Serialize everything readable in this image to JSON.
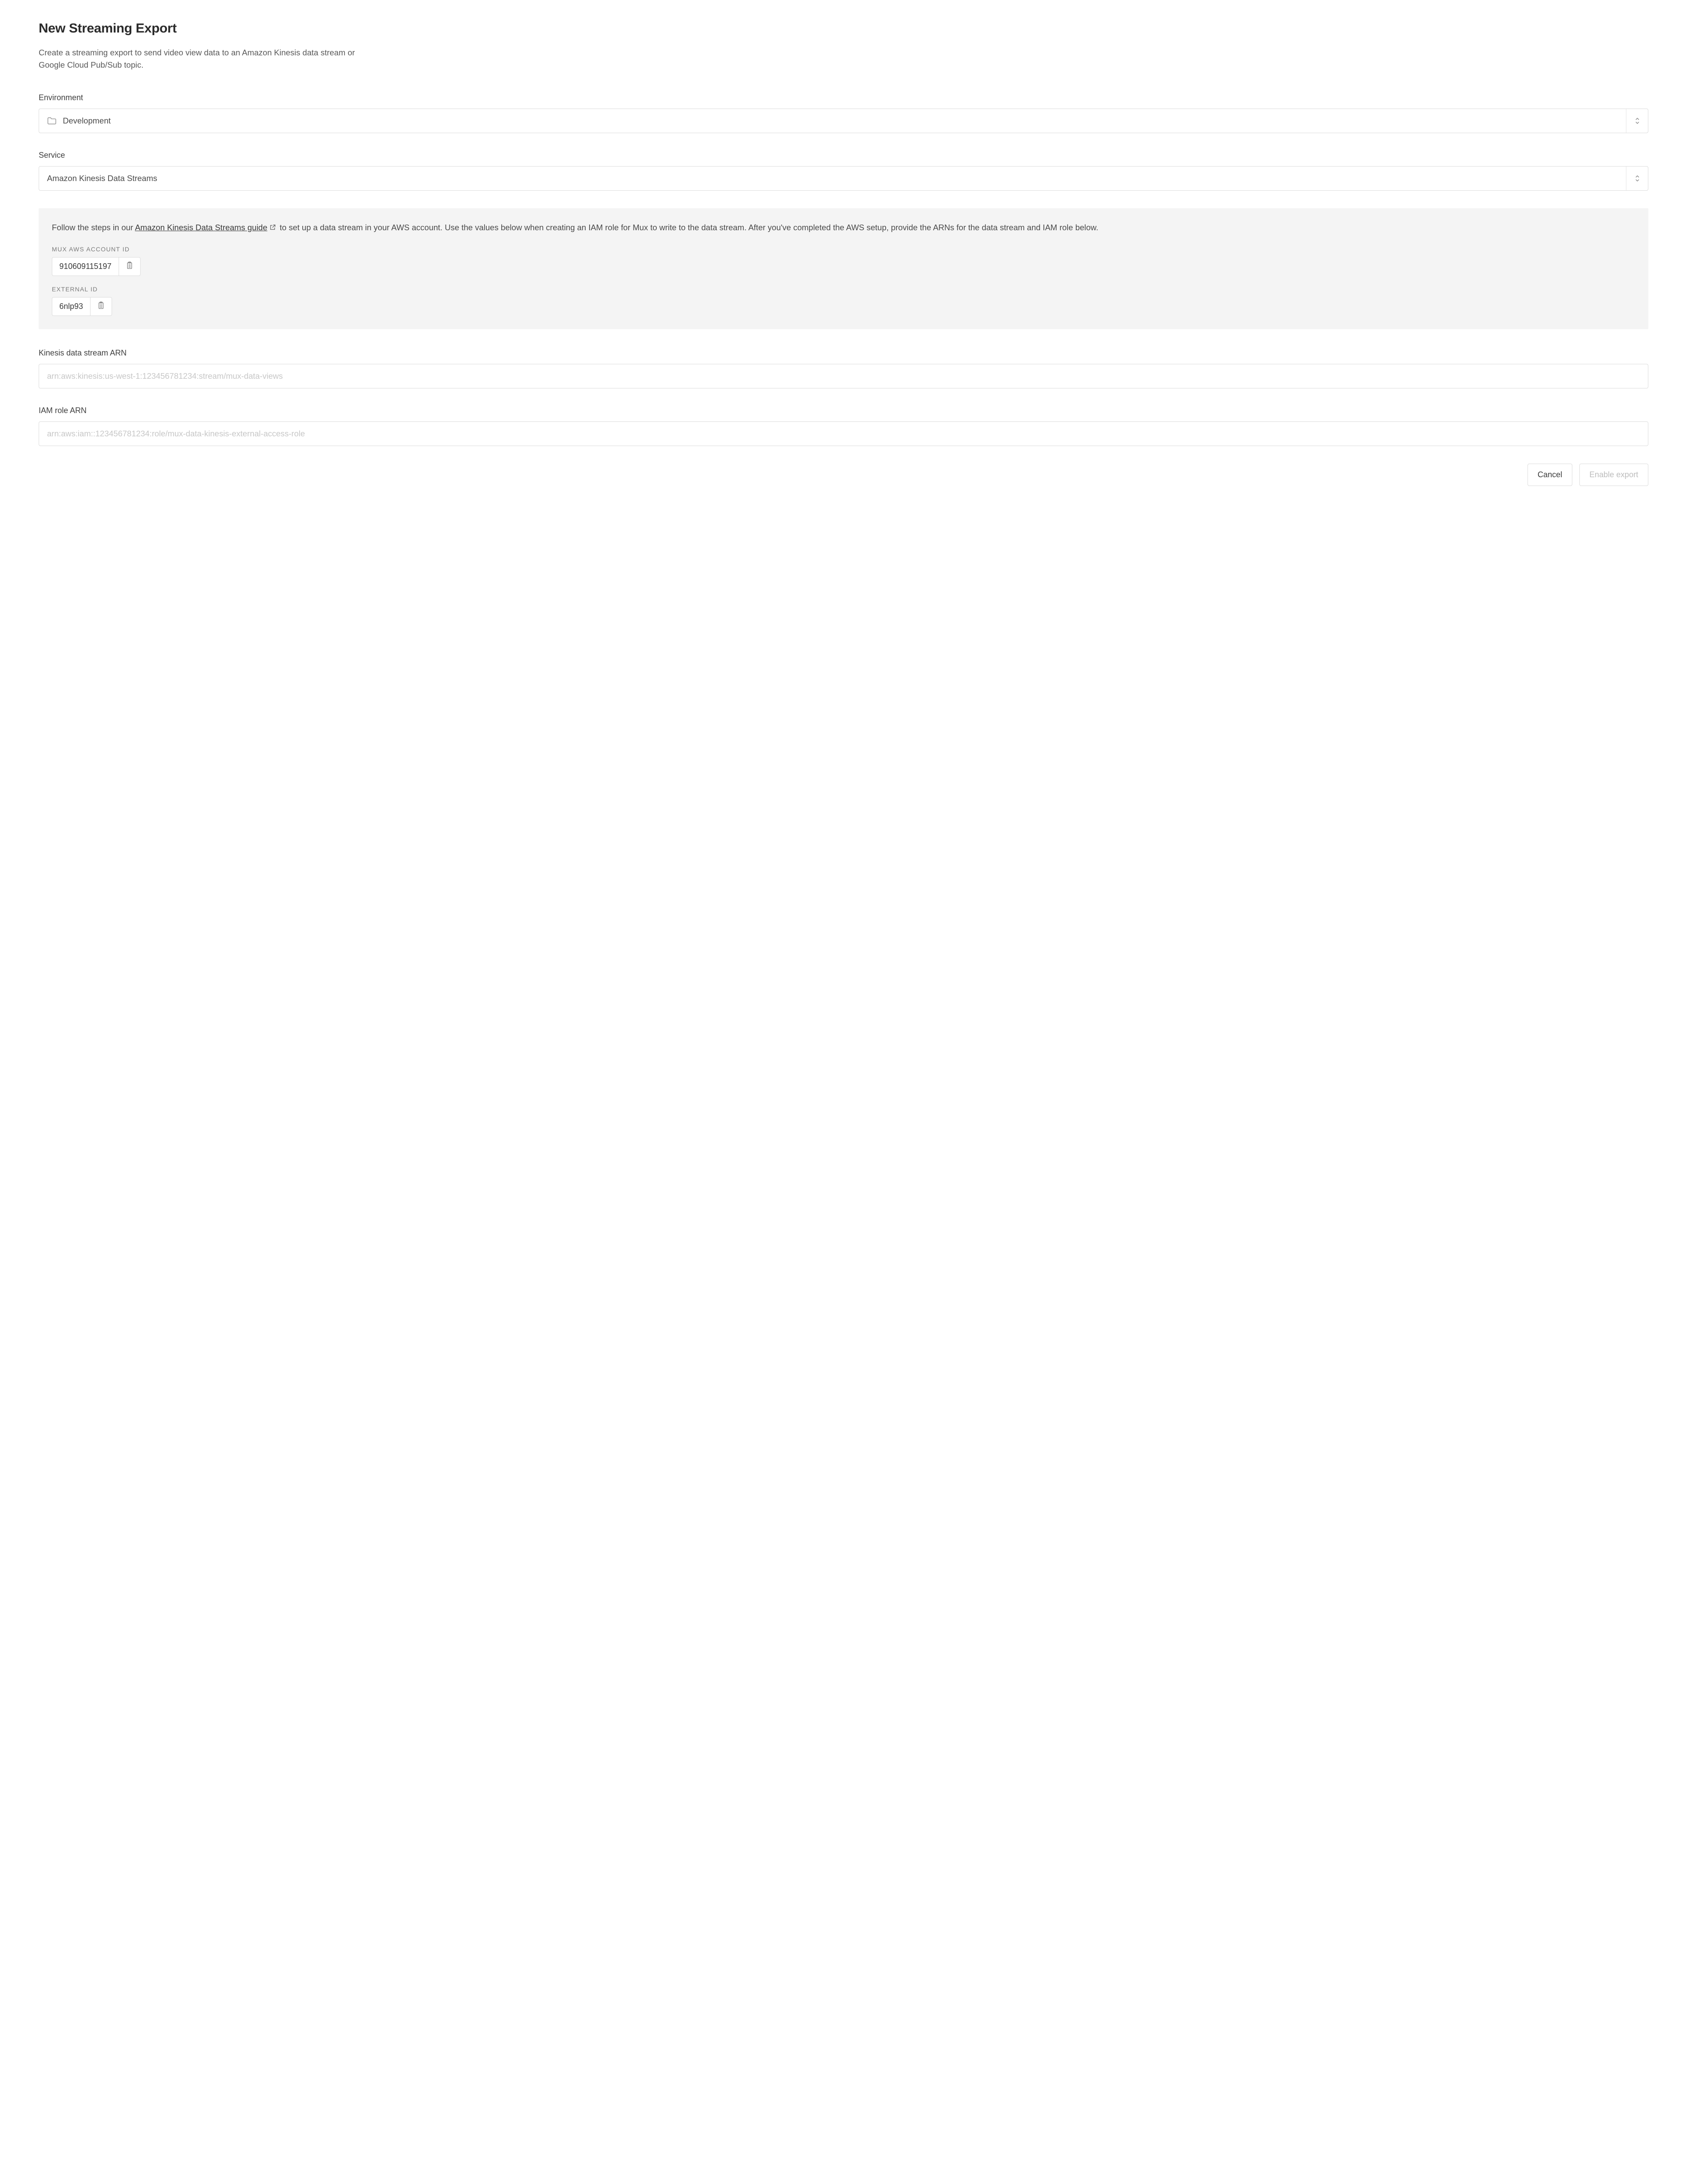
{
  "page": {
    "title": "New Streaming Export",
    "subtitle": "Create a streaming export to send video view data to an Amazon Kinesis data stream or Google Cloud Pub/Sub topic."
  },
  "environment": {
    "label": "Environment",
    "value": "Development"
  },
  "service": {
    "label": "Service",
    "value": "Amazon Kinesis Data Streams"
  },
  "info": {
    "text_before": "Follow the steps in our ",
    "link_text": "Amazon Kinesis Data Streams guide",
    "text_after": " to set up a data stream in your AWS account. Use the values below when creating an IAM role for Mux to write to the data stream. After you've completed the AWS setup, provide the ARNs for the data stream and IAM role below.",
    "account_id": {
      "label": "MUX AWS ACCOUNT ID",
      "value": "910609115197"
    },
    "external_id": {
      "label": "EXTERNAL ID",
      "value": "6nlp93"
    }
  },
  "stream_arn": {
    "label": "Kinesis data stream ARN",
    "placeholder": "arn:aws:kinesis:us-west-1:123456781234:stream/mux-data-views",
    "value": ""
  },
  "iam_arn": {
    "label": "IAM role ARN",
    "placeholder": "arn:aws:iam::123456781234:role/mux-data-kinesis-external-access-role",
    "value": ""
  },
  "actions": {
    "cancel": "Cancel",
    "enable": "Enable export"
  }
}
